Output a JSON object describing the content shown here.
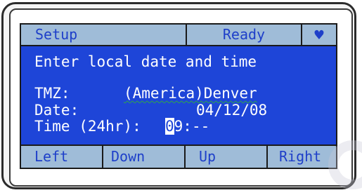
{
  "status_bar": {
    "mode": "Setup",
    "state": "Ready",
    "icon": "heart-icon"
  },
  "prompt": "Enter local date and time",
  "fields": {
    "tmz_label": "TMZ:",
    "tmz_value": "(America)Denver",
    "date_label": "Date:",
    "date_value": "04/12/08",
    "time_label": "Time (24hr):",
    "time_cursor_char": "0",
    "time_rest": "9:--"
  },
  "softkeys": {
    "left": "Left",
    "down": "Down",
    "up": "Up",
    "right": "Right"
  },
  "colors": {
    "screen_bg": "#1e45d8",
    "bar_bg": "#9fbcd8",
    "bar_text": "#1e3fc9",
    "text": "#ffffff"
  }
}
